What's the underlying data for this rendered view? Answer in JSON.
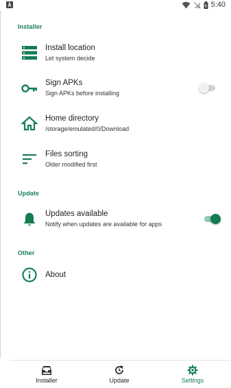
{
  "status_bar": {
    "time": "5:40"
  },
  "sections": {
    "installer": {
      "header": "Installer",
      "install_location": {
        "title": "Install location",
        "summary": "Let system decide"
      },
      "sign_apks": {
        "title": "Sign APKs",
        "summary": "Sign APKs before installing",
        "enabled": false
      },
      "home_directory": {
        "title": "Home directory",
        "summary": "/storage/emulated/0/Download"
      },
      "files_sorting": {
        "title": "Files sorting",
        "summary": "Older modified first"
      }
    },
    "update": {
      "header": "Update",
      "updates_available": {
        "title": "Updates available",
        "summary": "Notify when updates are available for apps",
        "enabled": true
      }
    },
    "other": {
      "header": "Other",
      "about": {
        "title": "About"
      }
    }
  },
  "bottom_nav": {
    "items": [
      {
        "label": "Installer",
        "icon": "installer-tray-icon",
        "active": false
      },
      {
        "label": "Update",
        "icon": "update-refresh-icon",
        "active": false
      },
      {
        "label": "Settings",
        "icon": "gear-icon",
        "active": true
      }
    ]
  },
  "colors": {
    "accent": "#137d52",
    "toggle_track_on": "#8fcbb0",
    "toggle_off": "#d3d3d3"
  }
}
